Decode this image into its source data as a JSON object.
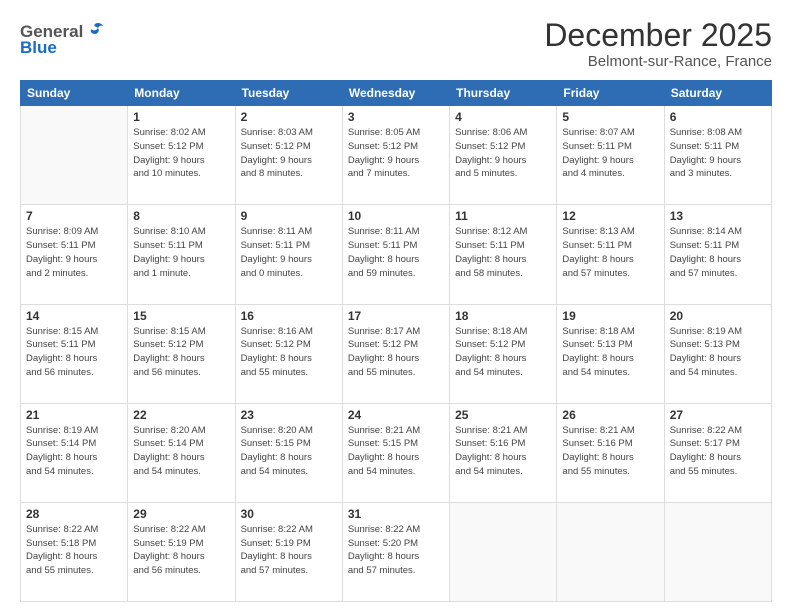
{
  "logo": {
    "general": "General",
    "blue": "Blue"
  },
  "title": "December 2025",
  "subtitle": "Belmont-sur-Rance, France",
  "weekdays": [
    "Sunday",
    "Monday",
    "Tuesday",
    "Wednesday",
    "Thursday",
    "Friday",
    "Saturday"
  ],
  "weeks": [
    [
      {
        "day": "",
        "info": ""
      },
      {
        "day": "1",
        "info": "Sunrise: 8:02 AM\nSunset: 5:12 PM\nDaylight: 9 hours\nand 10 minutes."
      },
      {
        "day": "2",
        "info": "Sunrise: 8:03 AM\nSunset: 5:12 PM\nDaylight: 9 hours\nand 8 minutes."
      },
      {
        "day": "3",
        "info": "Sunrise: 8:05 AM\nSunset: 5:12 PM\nDaylight: 9 hours\nand 7 minutes."
      },
      {
        "day": "4",
        "info": "Sunrise: 8:06 AM\nSunset: 5:12 PM\nDaylight: 9 hours\nand 5 minutes."
      },
      {
        "day": "5",
        "info": "Sunrise: 8:07 AM\nSunset: 5:11 PM\nDaylight: 9 hours\nand 4 minutes."
      },
      {
        "day": "6",
        "info": "Sunrise: 8:08 AM\nSunset: 5:11 PM\nDaylight: 9 hours\nand 3 minutes."
      }
    ],
    [
      {
        "day": "7",
        "info": "Sunrise: 8:09 AM\nSunset: 5:11 PM\nDaylight: 9 hours\nand 2 minutes."
      },
      {
        "day": "8",
        "info": "Sunrise: 8:10 AM\nSunset: 5:11 PM\nDaylight: 9 hours\nand 1 minute."
      },
      {
        "day": "9",
        "info": "Sunrise: 8:11 AM\nSunset: 5:11 PM\nDaylight: 9 hours\nand 0 minutes."
      },
      {
        "day": "10",
        "info": "Sunrise: 8:11 AM\nSunset: 5:11 PM\nDaylight: 8 hours\nand 59 minutes."
      },
      {
        "day": "11",
        "info": "Sunrise: 8:12 AM\nSunset: 5:11 PM\nDaylight: 8 hours\nand 58 minutes."
      },
      {
        "day": "12",
        "info": "Sunrise: 8:13 AM\nSunset: 5:11 PM\nDaylight: 8 hours\nand 57 minutes."
      },
      {
        "day": "13",
        "info": "Sunrise: 8:14 AM\nSunset: 5:11 PM\nDaylight: 8 hours\nand 57 minutes."
      }
    ],
    [
      {
        "day": "14",
        "info": "Sunrise: 8:15 AM\nSunset: 5:11 PM\nDaylight: 8 hours\nand 56 minutes."
      },
      {
        "day": "15",
        "info": "Sunrise: 8:15 AM\nSunset: 5:12 PM\nDaylight: 8 hours\nand 56 minutes."
      },
      {
        "day": "16",
        "info": "Sunrise: 8:16 AM\nSunset: 5:12 PM\nDaylight: 8 hours\nand 55 minutes."
      },
      {
        "day": "17",
        "info": "Sunrise: 8:17 AM\nSunset: 5:12 PM\nDaylight: 8 hours\nand 55 minutes."
      },
      {
        "day": "18",
        "info": "Sunrise: 8:18 AM\nSunset: 5:12 PM\nDaylight: 8 hours\nand 54 minutes."
      },
      {
        "day": "19",
        "info": "Sunrise: 8:18 AM\nSunset: 5:13 PM\nDaylight: 8 hours\nand 54 minutes."
      },
      {
        "day": "20",
        "info": "Sunrise: 8:19 AM\nSunset: 5:13 PM\nDaylight: 8 hours\nand 54 minutes."
      }
    ],
    [
      {
        "day": "21",
        "info": "Sunrise: 8:19 AM\nSunset: 5:14 PM\nDaylight: 8 hours\nand 54 minutes."
      },
      {
        "day": "22",
        "info": "Sunrise: 8:20 AM\nSunset: 5:14 PM\nDaylight: 8 hours\nand 54 minutes."
      },
      {
        "day": "23",
        "info": "Sunrise: 8:20 AM\nSunset: 5:15 PM\nDaylight: 8 hours\nand 54 minutes."
      },
      {
        "day": "24",
        "info": "Sunrise: 8:21 AM\nSunset: 5:15 PM\nDaylight: 8 hours\nand 54 minutes."
      },
      {
        "day": "25",
        "info": "Sunrise: 8:21 AM\nSunset: 5:16 PM\nDaylight: 8 hours\nand 54 minutes."
      },
      {
        "day": "26",
        "info": "Sunrise: 8:21 AM\nSunset: 5:16 PM\nDaylight: 8 hours\nand 55 minutes."
      },
      {
        "day": "27",
        "info": "Sunrise: 8:22 AM\nSunset: 5:17 PM\nDaylight: 8 hours\nand 55 minutes."
      }
    ],
    [
      {
        "day": "28",
        "info": "Sunrise: 8:22 AM\nSunset: 5:18 PM\nDaylight: 8 hours\nand 55 minutes."
      },
      {
        "day": "29",
        "info": "Sunrise: 8:22 AM\nSunset: 5:19 PM\nDaylight: 8 hours\nand 56 minutes."
      },
      {
        "day": "30",
        "info": "Sunrise: 8:22 AM\nSunset: 5:19 PM\nDaylight: 8 hours\nand 57 minutes."
      },
      {
        "day": "31",
        "info": "Sunrise: 8:22 AM\nSunset: 5:20 PM\nDaylight: 8 hours\nand 57 minutes."
      },
      {
        "day": "",
        "info": ""
      },
      {
        "day": "",
        "info": ""
      },
      {
        "day": "",
        "info": ""
      }
    ]
  ]
}
